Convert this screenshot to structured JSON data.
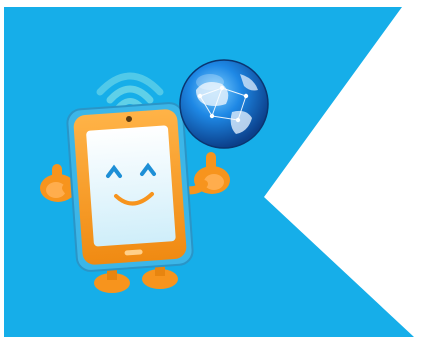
{
  "illustration": {
    "subject": "mascot-tablet-with-globe",
    "icons": [
      "wifi-signal-icon",
      "globe-icon",
      "tablet-mascot"
    ],
    "colors": {
      "banner_blue": "#16aee9",
      "background_white": "#ffffff",
      "tablet_orange": "#f7941d",
      "tablet_screen": "#dff3fb",
      "tablet_frame_blue": "#3cb6e8",
      "globe_blue": "#1565c0",
      "wifi_teal": "#5fd0e8"
    }
  }
}
